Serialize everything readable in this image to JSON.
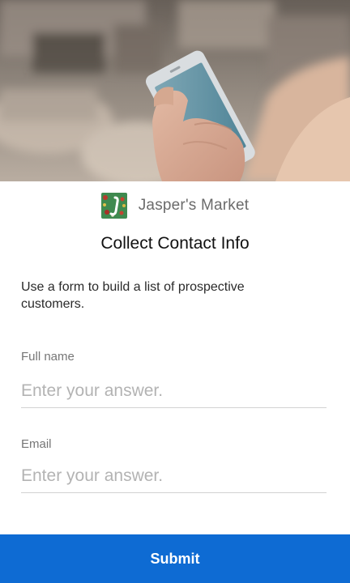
{
  "brand": {
    "name": "Jasper's Market",
    "logo_icon": "jaspers-market-logo"
  },
  "form": {
    "title": "Collect Contact Info",
    "description": "Use a form to build a list of prospective customers.",
    "fields": [
      {
        "label": "Full name",
        "placeholder": "Enter your answer.",
        "value": ""
      },
      {
        "label": "Email",
        "placeholder": "Enter your answer.",
        "value": ""
      }
    ],
    "submit_label": "Submit"
  },
  "colors": {
    "submit_background": "#0e6bd3",
    "brand_text": "#6b6b6b",
    "logo_background": "#3f8a4f"
  }
}
